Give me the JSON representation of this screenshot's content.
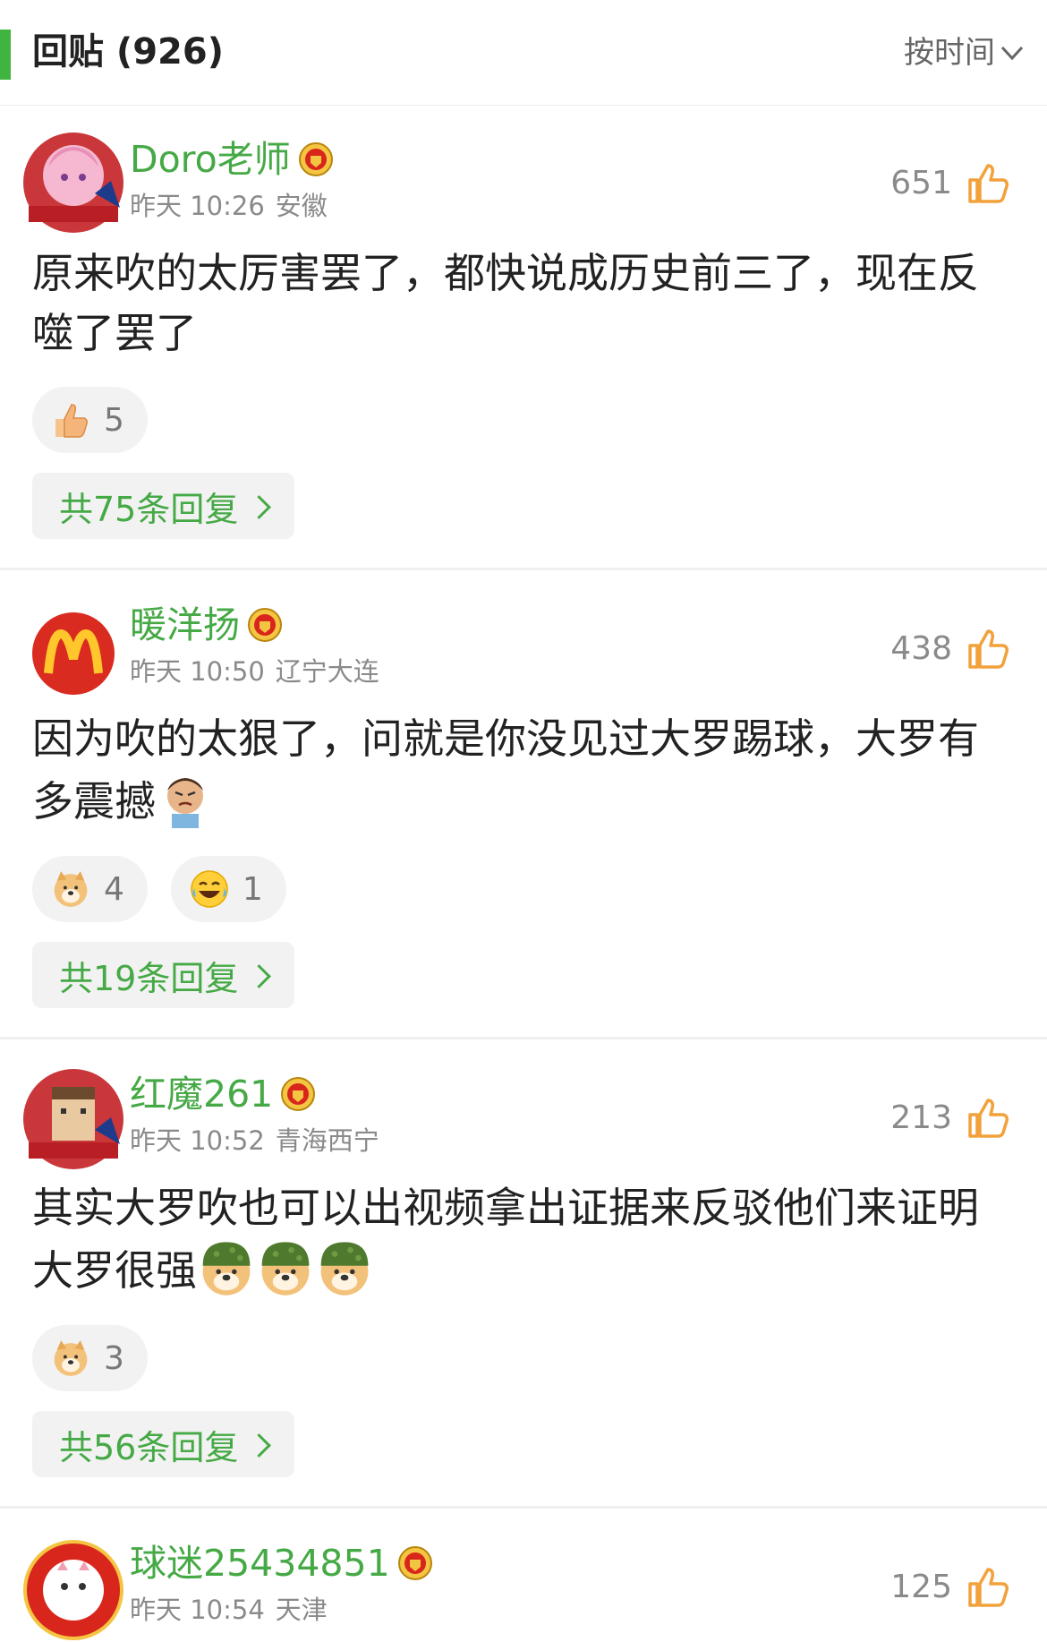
{
  "header": {
    "title": "回贴 (926)",
    "sort_label": "按时间"
  },
  "colors": {
    "accent_green": "#45a945",
    "bar_green": "#3fb53f",
    "text": "#222222",
    "meta_gray": "#8a8a8a"
  },
  "comments": [
    {
      "username": "Doro老师",
      "time": "昨天 10:26",
      "location": "安徽",
      "likes": "651",
      "text": "原来吹的太厉害罢了，都快说成历史前三了，现在反噬了罢了",
      "reactions": [
        {
          "icon": "thumbs-up-emoji",
          "count": "5"
        }
      ],
      "replies_label": "共75条回复"
    },
    {
      "username": "暖洋扬",
      "time": "昨天 10:50",
      "location": "辽宁大连",
      "likes": "438",
      "text": "因为吹的太狠了，问就是你没见过大罗踢球，大罗有多震撼",
      "reactions": [
        {
          "icon": "doge-emoji",
          "count": "4"
        },
        {
          "icon": "laughing-tears-emoji",
          "count": "1"
        }
      ],
      "replies_label": "共19条回复"
    },
    {
      "username": "红魔261",
      "time": "昨天 10:52",
      "location": "青海西宁",
      "likes": "213",
      "text": "其实大罗吹也可以出视频拿出证据来反驳他们来证明大罗很强",
      "reactions": [
        {
          "icon": "doge-salute-emoji",
          "count": "3"
        }
      ],
      "replies_label": "共56条回复"
    },
    {
      "username": "球迷25434851",
      "time": "昨天 10:54",
      "location": "天津",
      "likes": "125"
    }
  ]
}
